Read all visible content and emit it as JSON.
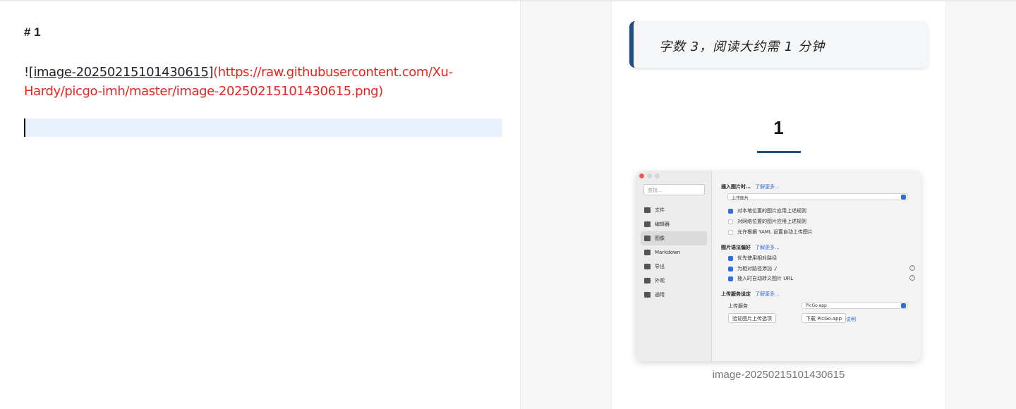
{
  "editor": {
    "heading": "# 1",
    "image_markdown": {
      "bang": "!",
      "alt": "[image-20250215101430615]",
      "url": "(https://raw.githubusercontent.com/Xu-Hardy/picgo-imh/master/image-20250215101430615.png)"
    }
  },
  "preview": {
    "word_count": "字数 3，阅读大约需 1 分钟",
    "heading": "1",
    "caption": "image-20250215101430615",
    "accent_color": "#1f4f86",
    "screenshot": {
      "search_placeholder": "查找...",
      "nav": [
        {
          "icon": "file-icon",
          "label": "文件"
        },
        {
          "icon": "pencil-icon",
          "label": "编辑器"
        },
        {
          "icon": "image-icon",
          "label": "图像"
        },
        {
          "icon": "markdown-icon",
          "label": "Markdown"
        },
        {
          "icon": "printer-icon",
          "label": "导出"
        },
        {
          "icon": "paint-bucket-icon",
          "label": "外观"
        },
        {
          "icon": "grid-icon",
          "label": "通用"
        }
      ],
      "insert_section": "插入图片时…",
      "learn_more": "了解更多...",
      "insert_select": "上传图片",
      "insert_checks": [
        {
          "label": "对本地位置的图片应用上述规则",
          "checked": true
        },
        {
          "label": "对网络位置的图片应用上述规则",
          "checked": false
        },
        {
          "label": "允许根据 YAML 设置自动上传图片",
          "checked": false
        }
      ],
      "syntax_section": "图片语法偏好",
      "syntax_checks": [
        {
          "label": "优先使用相对路径",
          "checked": true
        },
        {
          "label": "为相对路径添加 ./",
          "checked": true
        },
        {
          "label": "插入时自动转义图片 URL",
          "checked": true
        }
      ],
      "upload_section": "上传服务设定",
      "upload_label": "上传服务",
      "upload_select": "PicGo.app",
      "verify_button": "验证图片上传选项",
      "download_button": "下载 PicGo.app",
      "explain_link": "说明"
    }
  }
}
